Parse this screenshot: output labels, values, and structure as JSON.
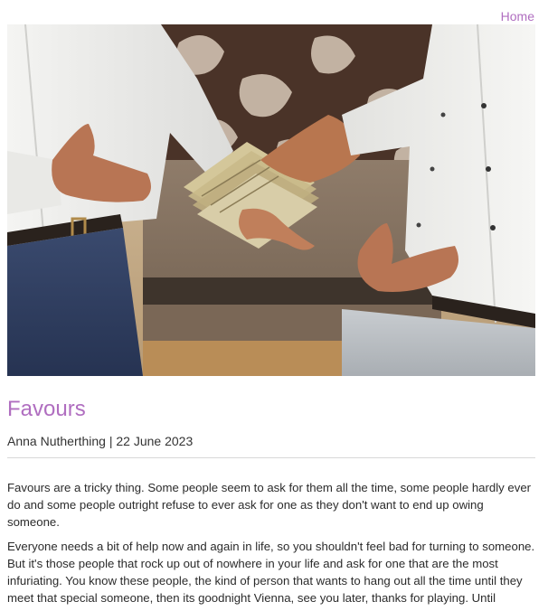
{
  "nav": {
    "home_label": "Home",
    "link_color": "#b06ec0"
  },
  "hero": {
    "image_icon": "hero-photo"
  },
  "post": {
    "title": "Favours",
    "author": "Anna Nutherthing",
    "separator": " | ",
    "date": "22 June 2023",
    "paragraphs": [
      "Favours are a tricky thing. Some people seem to ask for them all the time, some people hardly ever do and some people outright refuse to ever ask for one as they don't want to end up owing someone.",
      "Everyone needs a bit of help now and again in life, so you shouldn't feel bad for turning to someone. But it's those people that rock up out of nowhere in your life and ask for one that are the most infuriating. You know these people, the kind of person that wants to hang out all the time until they meet that special someone, then its goodnight Vienna, see you later, thanks for playing. Until"
    ]
  }
}
